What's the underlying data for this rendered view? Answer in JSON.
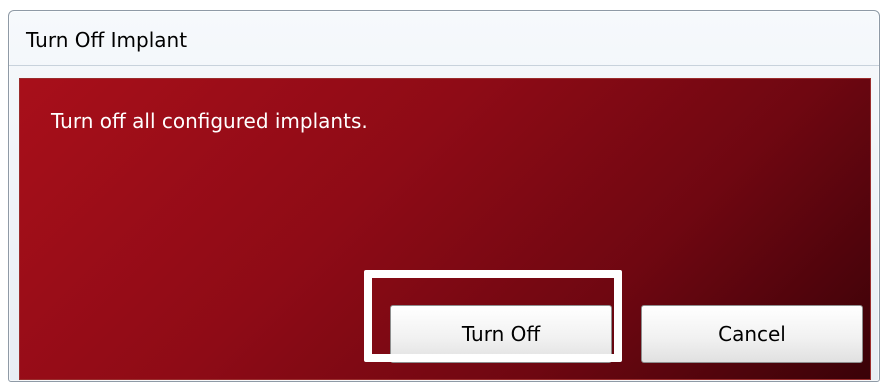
{
  "dialog": {
    "title": "Turn Off Implant",
    "message": "Turn off all configured implants.",
    "buttons": {
      "turn_off_label": "Turn Off",
      "cancel_label": "Cancel"
    }
  },
  "colors": {
    "client_gradient_start": "#a80f1a",
    "client_gradient_end": "#3a0208",
    "message_text": "#ffffff",
    "highlight": "#ffffff"
  }
}
